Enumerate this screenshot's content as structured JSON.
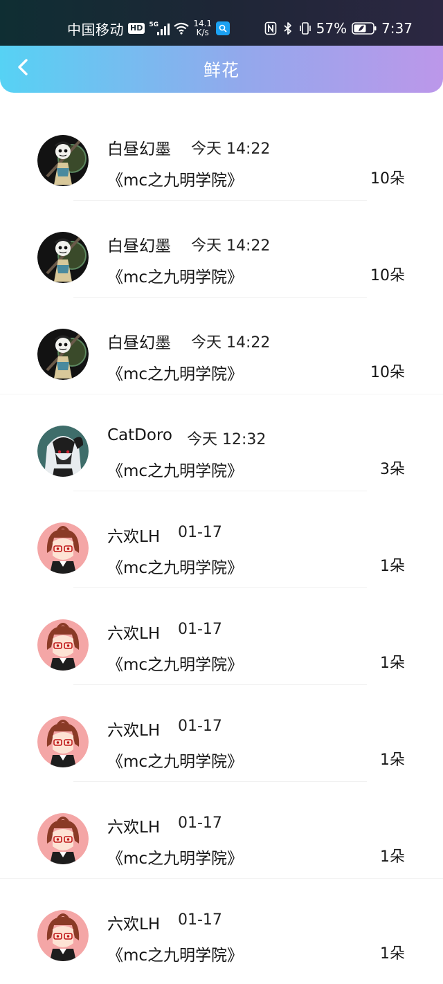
{
  "status_bar": {
    "carrier": "中国移动",
    "hd_badge": "HD",
    "network_type": "5G",
    "speed_value": "14.1",
    "speed_unit": "K/s",
    "battery_percent": "57%",
    "time": "7:37",
    "icons": [
      "hd-icon",
      "signal-icon",
      "wifi-icon",
      "search-app-icon",
      "nfc-icon",
      "bluetooth-icon",
      "vibrate-icon",
      "battery-icon"
    ]
  },
  "header": {
    "title": "鲜花",
    "back_icon": "chevron-left-icon",
    "gradient_start": "#56d2f4",
    "gradient_end": "#bc97ea"
  },
  "list": [
    {
      "name": "白昼幻墨",
      "time": "今天 14:22",
      "book": "《mc之九明学院》",
      "count": "10朵",
      "avatar": "skeleton-character-avatar"
    },
    {
      "name": "白昼幻墨",
      "time": "今天 14:22",
      "book": "《mc之九明学院》",
      "count": "10朵",
      "avatar": "skeleton-character-avatar"
    },
    {
      "name": "白昼幻墨",
      "time": "今天 14:22",
      "book": "《mc之九明学院》",
      "count": "10朵",
      "avatar": "skeleton-character-avatar"
    },
    {
      "name": "CatDoro",
      "time": "今天 12:32",
      "book": "《mc之九明学院》",
      "count": "3朵",
      "avatar": "hooded-character-avatar"
    },
    {
      "name": "六欢LH",
      "time": "01-17",
      "book": "《mc之九明学院》",
      "count": "1朵",
      "avatar": "glasses-girl-avatar"
    },
    {
      "name": "六欢LH",
      "time": "01-17",
      "book": "《mc之九明学院》",
      "count": "1朵",
      "avatar": "glasses-girl-avatar"
    },
    {
      "name": "六欢LH",
      "time": "01-17",
      "book": "《mc之九明学院》",
      "count": "1朵",
      "avatar": "glasses-girl-avatar"
    },
    {
      "name": "六欢LH",
      "time": "01-17",
      "book": "《mc之九明学院》",
      "count": "1朵",
      "avatar": "glasses-girl-avatar"
    },
    {
      "name": "六欢LH",
      "time": "01-17",
      "book": "《mc之九明学院》",
      "count": "1朵",
      "avatar": "glasses-girl-avatar"
    }
  ]
}
